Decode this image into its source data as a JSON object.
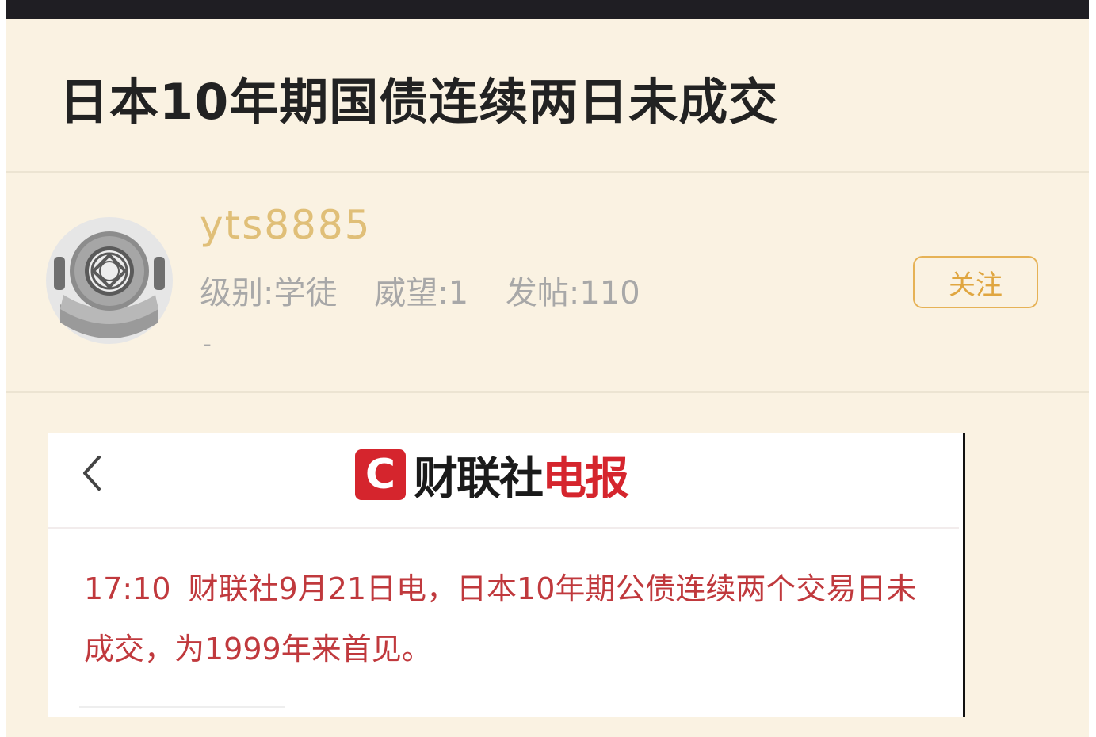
{
  "post": {
    "title": "日本10年期国债连续两日未成交"
  },
  "author": {
    "username": "yts8885",
    "level_label": "级别:学徒",
    "prestige_label": "威望:1",
    "posts_label": "发帖:110",
    "signature": "-",
    "avatar_icon": "diving-helmet-avatar-icon"
  },
  "actions": {
    "follow_label": "关注"
  },
  "embedded_screenshot": {
    "back_icon": "chevron-left-icon",
    "logo_letter": "C",
    "logo_text_part1": "财联社",
    "logo_text_part2": "电报",
    "news_time": "17:10",
    "news_body": "财联社9月21日电，日本10年期公债连续两个交易日未成交，为1999年来首见。"
  },
  "colors": {
    "background": "#faf2e2",
    "accent": "#e0a640",
    "news_red": "#c0393d",
    "logo_red": "#d5252d"
  }
}
